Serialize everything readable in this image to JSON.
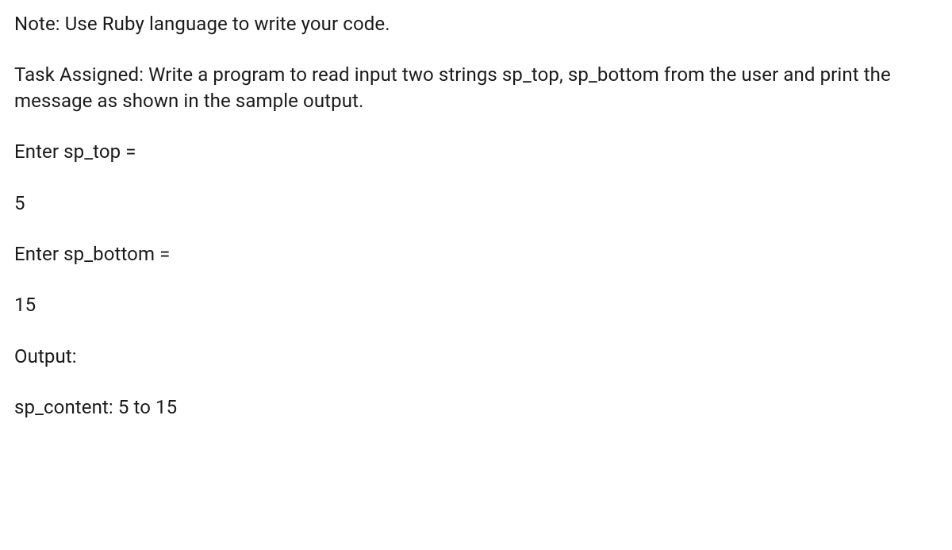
{
  "note": "Note: Use Ruby language to write your code.",
  "task": "Task Assigned: Write a program to read input two strings sp_top, sp_bottom from the user and print the message as shown in the sample output.",
  "prompts": {
    "sp_top_label": "Enter sp_top =",
    "sp_top_value": "5",
    "sp_bottom_label": "Enter sp_bottom =",
    "sp_bottom_value": "15"
  },
  "output_label": "Output:",
  "output_value": "sp_content: 5 to 15"
}
